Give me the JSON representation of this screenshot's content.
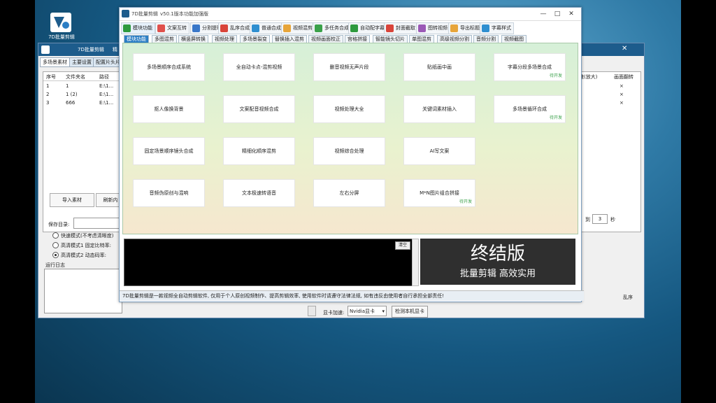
{
  "desktop": {
    "icon_label": "7D批量剪辑"
  },
  "back_window": {
    "title": "7D批量剪辑",
    "title_extra": "精",
    "tabs": [
      "多场景素材",
      "主要设置",
      "配置片头片"
    ],
    "columns": [
      "序号",
      "文件夹名",
      "路径"
    ],
    "rows": [
      {
        "idx": "1",
        "name": "1",
        "path": "E:\\1..."
      },
      {
        "idx": "2",
        "name": "1 (2)",
        "path": "E:\\1..."
      },
      {
        "idx": "3",
        "name": "666",
        "path": "E:\\1..."
      }
    ],
    "right_columns": [
      "速(放大)",
      "画面翻转"
    ],
    "right_marks": [
      "×",
      "×",
      "×"
    ],
    "import_button": "导入素材",
    "refresh_button": "刷新内",
    "save_dir_label": "保存目录:",
    "radios": [
      {
        "label": "快速模式(不考虑清晰度)",
        "checked": false
      },
      {
        "label": "高清模式1 固定比特率:",
        "checked": false
      },
      {
        "label": "高清模式2 动态码率:",
        "checked": true
      }
    ],
    "log_label": "运行日志",
    "to_label": "到",
    "seconds_value": "3",
    "seconds_unit": "秒",
    "gpu_label": "显卡加速:",
    "gpu_value": "Nvidia显卡",
    "gpu_check_button": "检测本机显卡",
    "right_tag": "乱序"
  },
  "front_window": {
    "title": "7D批量剪辑",
    "version": "v50.1版本",
    "edition": "功能加强版",
    "toolbar": [
      {
        "label": "模块功能",
        "color": "#2e9a3e"
      },
      {
        "label": "文案互转",
        "color": "#e0504b"
      },
      {
        "label": "分割提取",
        "color": "#3a78c9"
      },
      {
        "label": "乱序合成",
        "color": "#d9443a"
      },
      {
        "label": "普通合成",
        "color": "#2f8fd0"
      },
      {
        "label": "视频混剪",
        "color": "#e7a53a"
      },
      {
        "label": "多任务合成",
        "color": "#3aa14a"
      },
      {
        "label": "自动配字幕",
        "color": "#2e9a3e"
      },
      {
        "label": "封面截取",
        "color": "#d9443a"
      },
      {
        "label": "图转视频",
        "color": "#9b59b6"
      },
      {
        "label": "导出标题",
        "color": "#e7a53a"
      },
      {
        "label": "字幕样式",
        "color": "#2f8fd0"
      }
    ],
    "tabs": [
      "模块功能",
      "多图混剪",
      "横竖屏转换",
      "视频处理",
      "多场景裂变",
      "替换插入混剪",
      "视频画面校正",
      "宫格拼接",
      "智能镜头切片",
      "单图混剪",
      "高级视频分割",
      "音频分割",
      "视频截图"
    ],
    "cards": [
      {
        "label": "多场景顺序合成系统",
        "dev": ""
      },
      {
        "label": "全自动卡点-混剪视频",
        "dev": ""
      },
      {
        "label": "删音视频无声片段",
        "dev": ""
      },
      {
        "label": "贴纸画中画",
        "dev": ""
      },
      {
        "label": "字幕分段多场景合成",
        "dev": "待开发"
      },
      {
        "label": "抠人像换背景",
        "dev": ""
      },
      {
        "label": "文案配音视频合成",
        "dev": ""
      },
      {
        "label": "视频处理大全",
        "dev": ""
      },
      {
        "label": "关键词素材插入",
        "dev": ""
      },
      {
        "label": "多场景循环合成",
        "dev": "待开发"
      },
      {
        "label": "固定场景顺序镜头合成",
        "dev": ""
      },
      {
        "label": "精细化顺序混剪",
        "dev": ""
      },
      {
        "label": "视频综合处理",
        "dev": ""
      },
      {
        "label": "AI写文案",
        "dev": ""
      },
      {
        "label": "音频伪原创与混响",
        "dev": ""
      },
      {
        "label": "文本极速转语音",
        "dev": ""
      },
      {
        "label": "左右分屏",
        "dev": ""
      },
      {
        "label": "M*N图片组合拼接",
        "dev": "待开发"
      }
    ],
    "clear_button": "清空",
    "promo_title": "终结版",
    "promo_subtitle": "批量剪辑 高效实用",
    "status_text": "7D批量剪辑是一款视频全自动剪辑软件, 仅用于个人原创视频制作、提高剪辑效率, 使用软件时请遵守法律法规, 如有违反由使用者自行承担全部责任!"
  }
}
